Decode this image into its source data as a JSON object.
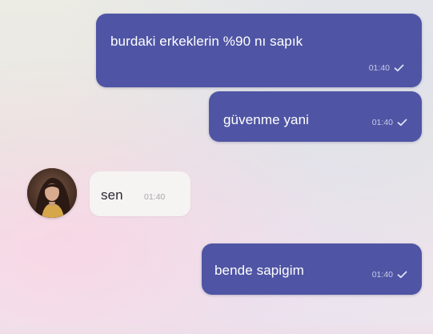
{
  "conversation": {
    "messages": [
      {
        "direction": "outgoing",
        "text": "burdaki erkeklerin %90 nı sapık",
        "time": "01:40",
        "status_icon": "check-icon"
      },
      {
        "direction": "outgoing",
        "text": "güvenme yani",
        "time": "01:40",
        "status_icon": "check-icon"
      },
      {
        "direction": "incoming",
        "text": "sen",
        "time": "01:40",
        "sender_avatar": "avatar-photo"
      },
      {
        "direction": "outgoing",
        "text": "bende sapigim",
        "time": "01:40",
        "status_icon": "check-icon"
      }
    ]
  },
  "colors": {
    "outgoing_bubble": "#4f55a4",
    "incoming_bubble": "#f6f3f3",
    "outgoing_text": "#ffffff",
    "incoming_text": "#2b2b33"
  }
}
